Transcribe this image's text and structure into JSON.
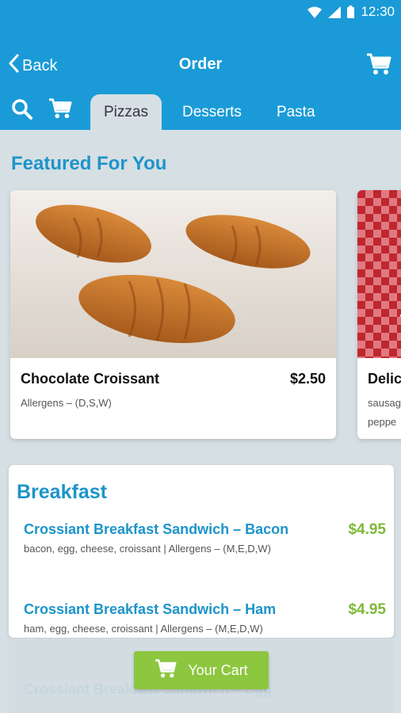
{
  "status_bar": {
    "time": "12:30",
    "icons": [
      "wifi-icon",
      "signal-icon",
      "battery-icon"
    ]
  },
  "app_bar": {
    "back_label": "Back",
    "title": "Order",
    "tabs": [
      {
        "label": "Pizzas",
        "active": true
      },
      {
        "label": "Desserts",
        "active": false
      },
      {
        "label": "Pasta",
        "active": false
      }
    ]
  },
  "featured": {
    "heading": "Featured For You",
    "cards": [
      {
        "name": "Chocolate Croissant",
        "price": "$2.50",
        "allergens": "Allergens – (D,S,W)"
      },
      {
        "name": "Delic",
        "price": "",
        "line1": "sausag",
        "line2": "peppe"
      }
    ]
  },
  "menu": {
    "section_title": "Breakfast",
    "items": [
      {
        "name": "Crossiant Breakfast Sandwich – Bacon",
        "price": "$4.95",
        "description": "bacon, egg, cheese, croissant | Allergens – (M,E,D,W)"
      },
      {
        "name": "Crossiant Breakfast Sandwich – Ham",
        "price": "$4.95",
        "description": "ham, egg, cheese, croissant | Allergens – (M,E,D,W)"
      }
    ],
    "faded_next": "Crossiant Breakfast Sandwich – Egg"
  },
  "cart_button": {
    "label": "Your Cart"
  },
  "colors": {
    "primary": "#1a9bd7",
    "accent_green": "#8dc63f",
    "price_green": "#7fb93a",
    "heading_blue": "#1d94c9",
    "background": "#d6dfe3"
  }
}
